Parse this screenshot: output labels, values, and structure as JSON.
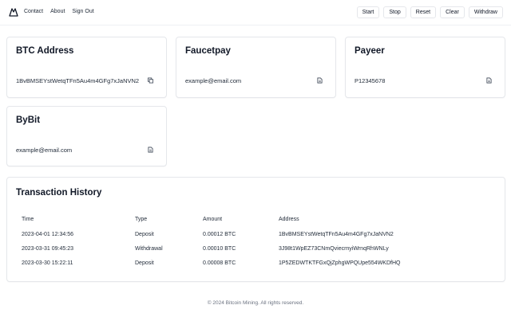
{
  "nav": {
    "links": [
      "Contact",
      "About",
      "Sign Out"
    ],
    "actions": [
      "Start",
      "Stop",
      "Reset",
      "Clear",
      "Withdraw"
    ]
  },
  "cards": [
    {
      "title": "BTC Address",
      "value": "1BvBMSEYstWetqTFn5Au4m4GFg7xJaNVN2",
      "icon": "copy-icon"
    },
    {
      "title": "Faucetpay",
      "value": "example@email.com",
      "icon": "document-icon"
    },
    {
      "title": "Payeer",
      "value": "P12345678",
      "icon": "document-icon"
    },
    {
      "title": "ByBit",
      "value": "example@email.com",
      "icon": "document-icon"
    }
  ],
  "transactions": {
    "title": "Transaction History",
    "columns": [
      "Time",
      "Type",
      "Amount",
      "Address"
    ],
    "rows": [
      [
        "2023-04-01 12:34:56",
        "Deposit",
        "0.00012 BTC",
        "1BvBMSEYstWetqTFn5Au4m4GFg7xJaNVN2"
      ],
      [
        "2023-03-31 09:45:23",
        "Withdrawal",
        "0.00010 BTC",
        "3J98t1WpEZ73CNmQviecrnyiWrnqRhWNLy"
      ],
      [
        "2023-03-30 15:22:11",
        "Deposit",
        "0.00008 BTC",
        "1P5ZEDWTKTFGxQjZphgWPQUpe554WKDfHQ"
      ]
    ]
  },
  "footer": "© 2024 Bitcoin Mining. All rights reserved."
}
